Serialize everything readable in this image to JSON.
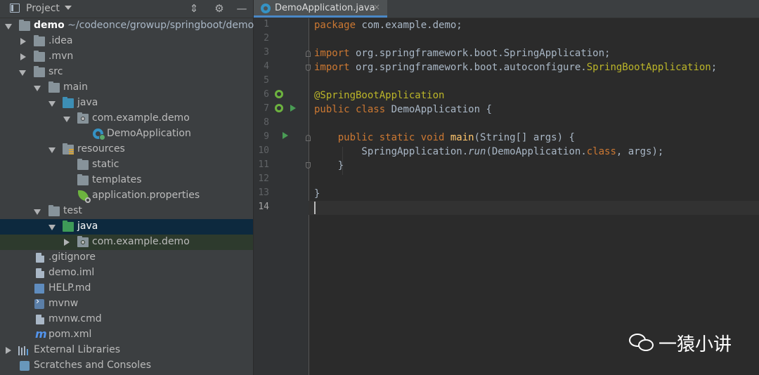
{
  "project_panel": {
    "title": "Project",
    "header_buttons": [
      "collapse-all-icon",
      "gear-icon",
      "minimize-icon"
    ],
    "tree": [
      {
        "label": "demo",
        "path": " ~/codeonce/growup/springboot/demo",
        "icon": "module-folder-icon",
        "expanded": true
      },
      {
        "label": ".idea",
        "icon": "folder-icon",
        "expanded": false
      },
      {
        "label": ".mvn",
        "icon": "folder-icon",
        "expanded": false
      },
      {
        "label": "src",
        "icon": "folder-icon",
        "expanded": true
      },
      {
        "label": "main",
        "icon": "folder-icon",
        "expanded": true
      },
      {
        "label": "java",
        "icon": "source-folder-icon",
        "expanded": true
      },
      {
        "label": "com.example.demo",
        "icon": "package-icon",
        "expanded": true
      },
      {
        "label": "DemoApplication",
        "icon": "spring-boot-class-icon"
      },
      {
        "label": "resources",
        "icon": "resources-folder-icon",
        "expanded": true
      },
      {
        "label": "static",
        "icon": "folder-icon"
      },
      {
        "label": "templates",
        "icon": "folder-icon"
      },
      {
        "label": "application.properties",
        "icon": "spring-properties-icon"
      },
      {
        "label": "test",
        "icon": "folder-icon",
        "expanded": true
      },
      {
        "label": "java",
        "icon": "test-source-folder-icon",
        "expanded": true
      },
      {
        "label": "com.example.demo",
        "icon": "package-icon",
        "expanded": false
      },
      {
        "label": ".gitignore",
        "icon": "file-icon"
      },
      {
        "label": "demo.iml",
        "icon": "file-icon"
      },
      {
        "label": "HELP.md",
        "icon": "markdown-icon"
      },
      {
        "label": "mvnw",
        "icon": "terminal-icon"
      },
      {
        "label": "mvnw.cmd",
        "icon": "file-icon"
      },
      {
        "label": "pom.xml",
        "icon": "maven-icon"
      },
      {
        "label": "External Libraries",
        "icon": "libraries-icon",
        "expanded": false
      },
      {
        "label": "Scratches and Consoles",
        "icon": "scratches-icon"
      }
    ]
  },
  "editor": {
    "tab": {
      "label": "DemoApplication.java",
      "close": "×"
    },
    "line_numbers": [
      "1",
      "2",
      "3",
      "4",
      "5",
      "6",
      "7",
      "8",
      "9",
      "10",
      "11",
      "12",
      "13",
      "14"
    ],
    "lines": [
      "package com.example.demo;",
      "",
      "import org.springframework.boot.SpringApplication;",
      "import org.springframework.boot.autoconfigure.SpringBootApplication;",
      "",
      "@SpringBootApplication",
      "public class DemoApplication {",
      "",
      "    public static void main(String[] args) {",
      "        SpringApplication.run(DemoApplication.class, args);",
      "    }",
      "",
      "}",
      ""
    ],
    "current_line": "14"
  },
  "watermark": {
    "text": "一猿小讲",
    "icon": "wechat-icon"
  },
  "colors": {
    "keyword": "#cc7832",
    "annotation": "#bbb529",
    "method": "#ffc66d",
    "text": "#a9b7c6",
    "selection": "#0d293e",
    "accent": "#4a88c7"
  }
}
